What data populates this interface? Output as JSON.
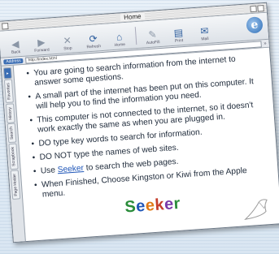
{
  "window": {
    "title": "Home"
  },
  "toolbar": {
    "buttons": [
      {
        "label": "Back",
        "icon": "back-arrow-icon",
        "active": false
      },
      {
        "label": "Forward",
        "icon": "forward-arrow-icon",
        "active": false
      },
      {
        "label": "Stop",
        "icon": "stop-icon",
        "active": false
      },
      {
        "label": "Refresh",
        "icon": "refresh-icon",
        "active": true
      },
      {
        "label": "Home",
        "icon": "home-icon",
        "active": true
      },
      {
        "label": "AutoFill",
        "icon": "autofill-icon",
        "active": false
      },
      {
        "label": "Print",
        "icon": "print-icon",
        "active": true
      },
      {
        "label": "Mail",
        "icon": "mail-icon",
        "active": true
      }
    ]
  },
  "address": {
    "label": "Address",
    "url": "http://index.html"
  },
  "sidebar": {
    "tabs": [
      "Favorites",
      "History",
      "Search",
      "Scrapbook",
      "Page Holder"
    ]
  },
  "instructions": [
    "You are going to search information from the internet to answer some questions.",
    "A small part of the internet has been put on this computer. It will help you to find the information you need.",
    "This computer is not connected to the internet, so it doesn't work exactly the same as when you are plugged in.",
    "DO type key words to search for information.",
    "DO NOT type the names of web sites."
  ],
  "seeker_line": {
    "before": "Use ",
    "link": "Seeker",
    "after": " to search the web pages."
  },
  "final_instruction": "When Finished, Choose Kingston or Kiwi from the Apple menu.",
  "brand": {
    "letters": [
      "S",
      "e",
      "e",
      "k",
      "e",
      "r"
    ]
  },
  "colors": {
    "accent": "#3b6eb4",
    "link": "#1f56b8"
  }
}
